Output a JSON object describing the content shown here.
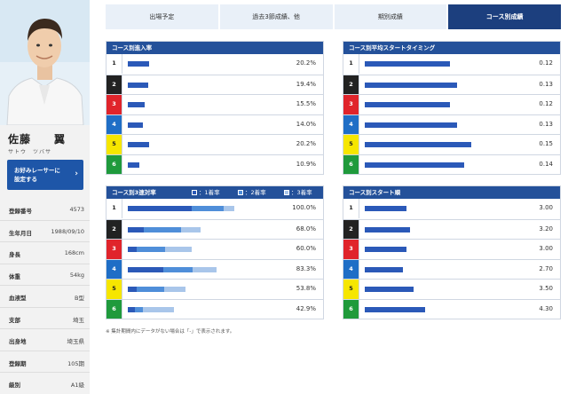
{
  "colors": {
    "header": "#24519a",
    "tab_active": "#1c3f7e",
    "tab_inactive": "#e9f0f8",
    "bar_first": "#2b59b8",
    "bar_second": "#4f8ed9",
    "bar_third": "#a9c6ea",
    "fav_button": "#1e56a8"
  },
  "tabs": [
    {
      "label": "出場予定",
      "active": false
    },
    {
      "label": "過去3節成績、他",
      "active": false
    },
    {
      "label": "期別成績",
      "active": false
    },
    {
      "label": "コース別成績",
      "active": true
    }
  ],
  "racer": {
    "name": "佐藤　　翼",
    "kana": "サトウ　ツバサ",
    "favorite_button": "お好みレーサーに\n設定する",
    "profile": [
      {
        "label": "登録番号",
        "value": "4573"
      },
      {
        "label": "生年月日",
        "value": "1988/09/10"
      },
      {
        "label": "身長",
        "value": "168cm"
      },
      {
        "label": "体重",
        "value": "54kg"
      },
      {
        "label": "血液型",
        "value": "B型"
      },
      {
        "label": "支部",
        "value": "埼玉"
      },
      {
        "label": "出身地",
        "value": "埼玉県"
      },
      {
        "label": "登録期",
        "value": "105期"
      },
      {
        "label": "級別",
        "value": "A1級"
      }
    ]
  },
  "panels": {
    "entry_rate": {
      "title": "コース別進入率",
      "rows": [
        {
          "course": "1",
          "value": 20.2,
          "text": "20.2%"
        },
        {
          "course": "2",
          "value": 19.4,
          "text": "19.4%"
        },
        {
          "course": "3",
          "value": 15.5,
          "text": "15.5%"
        },
        {
          "course": "4",
          "value": 14.0,
          "text": "14.0%"
        },
        {
          "course": "5",
          "value": 20.2,
          "text": "20.2%"
        },
        {
          "course": "6",
          "value": 10.9,
          "text": "10.9%"
        }
      ]
    },
    "start_timing": {
      "title": "コース別平均スタートタイミング",
      "rows": [
        {
          "course": "1",
          "value": 0.12,
          "text": "0.12"
        },
        {
          "course": "2",
          "value": 0.13,
          "text": "0.13"
        },
        {
          "course": "3",
          "value": 0.12,
          "text": "0.12"
        },
        {
          "course": "4",
          "value": 0.13,
          "text": "0.13"
        },
        {
          "course": "5",
          "value": 0.15,
          "text": "0.15"
        },
        {
          "course": "6",
          "value": 0.14,
          "text": "0.14"
        }
      ]
    },
    "top3_rate": {
      "title": "コース別3連対率",
      "legend": [
        "：1着率",
        "：2着率",
        "：3着率"
      ],
      "rows": [
        {
          "course": "1",
          "first": 60,
          "second": 30,
          "third": 10,
          "text": "100.0%"
        },
        {
          "course": "2",
          "first": 15,
          "second": 35,
          "third": 18,
          "text": "68.0%"
        },
        {
          "course": "3",
          "first": 8,
          "second": 27,
          "third": 25,
          "text": "60.0%"
        },
        {
          "course": "4",
          "first": 33,
          "second": 28,
          "third": 22,
          "text": "83.3%"
        },
        {
          "course": "5",
          "first": 8,
          "second": 26,
          "third": 20,
          "text": "53.8%"
        },
        {
          "course": "6",
          "first": 7,
          "second": 7,
          "third": 29,
          "text": "42.9%"
        }
      ]
    },
    "start_order": {
      "title": "コース別スタート順",
      "rows": [
        {
          "course": "1",
          "value": 3.0,
          "text": "3.00"
        },
        {
          "course": "2",
          "value": 3.2,
          "text": "3.20"
        },
        {
          "course": "3",
          "value": 3.0,
          "text": "3.00"
        },
        {
          "course": "4",
          "value": 2.7,
          "text": "2.70"
        },
        {
          "course": "5",
          "value": 3.5,
          "text": "3.50"
        },
        {
          "course": "6",
          "value": 4.3,
          "text": "4.30"
        }
      ]
    }
  },
  "footnote": "※ 集計期間内にデータがない場合は「-」で表示されます。"
}
